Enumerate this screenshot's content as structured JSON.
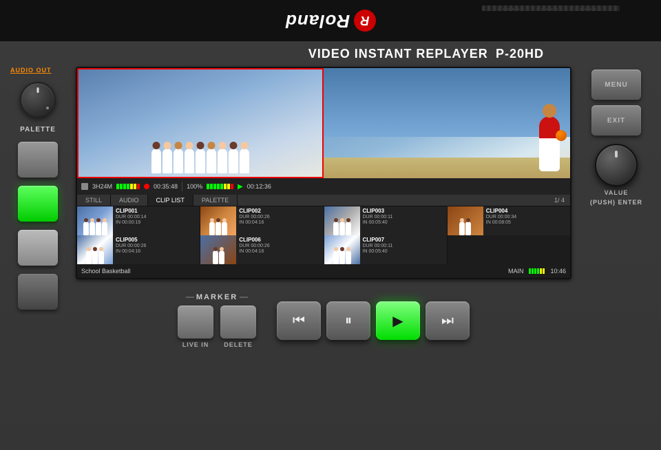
{
  "device": {
    "brand": "Roland",
    "model": "P-20HD",
    "subtitle": "VIDEO INSTANT REPLAYER"
  },
  "header": {
    "title": "VIDEO INSTANT REPLAYER",
    "model": "P-20HD"
  },
  "left_panel": {
    "audio_out_label": "AUDIO OUT",
    "palette_label": "PALETTE"
  },
  "display": {
    "status_bar": {
      "format": "3H24M",
      "rec_time": "00:35:48",
      "zoom": "100%",
      "play_time": "00:12:36"
    },
    "tabs": [
      "STILL",
      "AUDIO",
      "CLIP LIST",
      "PALETTE"
    ],
    "tab_active": "CLIP LIST",
    "page_info": "1/ 4",
    "clips": [
      {
        "id": "CLIP001",
        "dur": "00:00:14",
        "in": "00:00:19",
        "thumb_class": "ct-1"
      },
      {
        "id": "CLIP002",
        "dur": "00:00:26",
        "in": "00:04:16",
        "thumb_class": "ct-2"
      },
      {
        "id": "CLIP003",
        "dur": "00:00:11",
        "in": "00:05:40",
        "thumb_class": "ct-3"
      },
      {
        "id": "CLIP004",
        "dur": "00:00:34",
        "in": "00:08:05",
        "thumb_class": "ct-4"
      },
      {
        "id": "CLIP005",
        "dur": "00:00:26",
        "in": "00:04:16",
        "thumb_class": "ct-5"
      },
      {
        "id": "CLIP006",
        "dur": "00:00:26",
        "in": "00:04:16",
        "thumb_class": "ct-6"
      },
      {
        "id": "CLIP007",
        "dur": "00:00:11",
        "in": "00:05:40",
        "thumb_class": "ct-7"
      }
    ],
    "info_bar": {
      "title": "School Basketball",
      "source": "MAIN",
      "time": "10:46"
    }
  },
  "marker": {
    "section_label": "MARKER",
    "live_in_label": "LIVE IN",
    "delete_label": "DELETE"
  },
  "transport": {
    "prev_label": "⏮",
    "pause_label": "⏸",
    "play_label": "▶",
    "next_label": "⏭"
  },
  "right_panel": {
    "menu_label": "MENU",
    "exit_label": "EXIT",
    "value_label": "VALUE",
    "push_enter_label": "(PUSH) ENTER"
  }
}
